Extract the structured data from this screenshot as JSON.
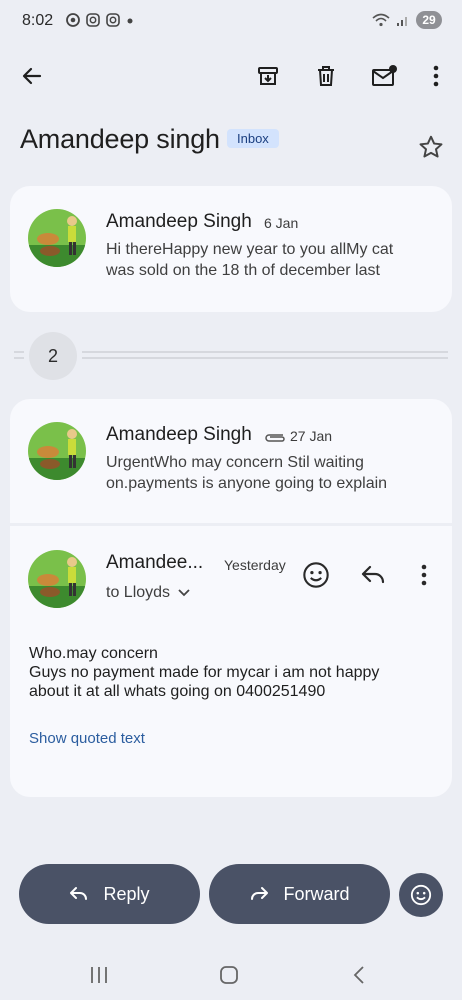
{
  "status_bar": {
    "time": "8:02",
    "battery": "29"
  },
  "toolbar": {
    "back": "back-arrow-icon",
    "archive": "archive-icon",
    "delete": "trash-icon",
    "mark_unread": "mail-unread-icon",
    "more": "more-vertical-icon"
  },
  "thread": {
    "subject": "Amandeep singh",
    "label": "Inbox"
  },
  "messages": [
    {
      "sender": "Amandeep Singh",
      "date": "6 Jan",
      "snippet_line1": "Hi thereHappy new year to you allMy cat",
      "snippet_line2": "was sold on the 18 th of december last"
    },
    {
      "sender": "Amandeep Singh",
      "date": "27 Jan",
      "has_attachment": true,
      "snippet_line1": "UrgentWho may concern Stil waiting",
      "snippet_line2": "on.payments is anyone going to explain"
    }
  ],
  "collapsed": {
    "count": "2"
  },
  "expanded": {
    "sender": "Amandee...",
    "date": "Yesterday",
    "to": "to Lloyds",
    "body": "Who.may concern\nGuys no payment made for mycar  i am not happy\nabout it at all whats going on 0400251490",
    "show_quoted": "Show quoted text"
  },
  "actions": {
    "reply": "Reply",
    "forward": "Forward"
  }
}
